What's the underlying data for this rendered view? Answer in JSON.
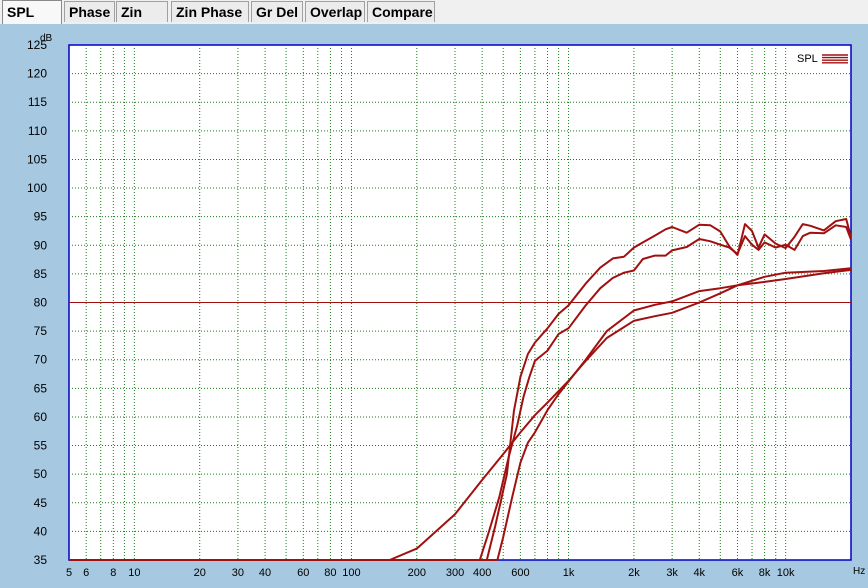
{
  "tabs": [
    {
      "label": "SPL",
      "active": true
    },
    {
      "label": "Phase"
    },
    {
      "label": "Zin"
    },
    {
      "label": "Zin Phase"
    },
    {
      "label": "Gr Del"
    },
    {
      "label": "Overlap"
    },
    {
      "label": "Compare"
    }
  ],
  "colors": {
    "background": "#a6c8e0",
    "plot_bg": "#ffffff",
    "grid": "#1a7a1a",
    "curve": "#a01010",
    "frame": "#0000c8"
  },
  "chart_data": {
    "type": "line",
    "title": "",
    "xlabel": "Hz",
    "ylabel": "dB",
    "x_scale": "log",
    "xlim": [
      5,
      20000
    ],
    "ylim": [
      35,
      125
    ],
    "grid": true,
    "legend": {
      "position": "top-right",
      "entries": [
        "SPL"
      ]
    },
    "y_ticks": [
      125,
      120,
      115,
      110,
      105,
      100,
      95,
      90,
      85,
      80,
      75,
      70,
      65,
      60,
      55,
      50,
      45,
      40,
      35
    ],
    "x_tick_labels": [
      {
        "x": 5,
        "label": "5"
      },
      {
        "x": 6,
        "label": "6"
      },
      {
        "x": 8,
        "label": "8"
      },
      {
        "x": 10,
        "label": "10"
      },
      {
        "x": 20,
        "label": "20"
      },
      {
        "x": 30,
        "label": "30"
      },
      {
        "x": 40,
        "label": "40"
      },
      {
        "x": 60,
        "label": "60"
      },
      {
        "x": 80,
        "label": "80"
      },
      {
        "x": 100,
        "label": "100"
      },
      {
        "x": 200,
        "label": "200"
      },
      {
        "x": 300,
        "label": "300"
      },
      {
        "x": 400,
        "label": "400"
      },
      {
        "x": 600,
        "label": "600"
      },
      {
        "x": 1000,
        "label": "1k"
      },
      {
        "x": 2000,
        "label": "2k"
      },
      {
        "x": 3000,
        "label": "3k"
      },
      {
        "x": 4000,
        "label": "4k"
      },
      {
        "x": 6000,
        "label": "6k"
      },
      {
        "x": 8000,
        "label": "8k"
      },
      {
        "x": 10000,
        "label": "10k"
      }
    ],
    "reference_line": {
      "y": 80
    },
    "series": [
      {
        "x": [
          5,
          150,
          200,
          300,
          400,
          500,
          600,
          700,
          800,
          1000,
          1200,
          1500,
          2000,
          2500,
          3000,
          4000,
          5000,
          6000,
          8000,
          10000,
          15000,
          20000
        ],
        "y": [
          35,
          35,
          37,
          43,
          49,
          53.5,
          57.3,
          60.3,
          62.5,
          66.3,
          69.8,
          73.8,
          76.8,
          77.6,
          78.2,
          80,
          81.6,
          83,
          84.5,
          85.2,
          85.5,
          86
        ]
      },
      {
        "x": [
          5,
          470,
          500,
          550,
          600,
          650,
          700,
          800,
          900,
          1000,
          1200,
          1500,
          2000,
          2500,
          3000,
          4000,
          5000,
          6000,
          8000,
          10000,
          15000,
          20000
        ],
        "y": [
          35,
          35,
          39,
          46,
          52,
          55.5,
          57.3,
          61.2,
          64,
          66.2,
          70,
          75,
          78.6,
          79.6,
          80.2,
          82,
          82.5,
          83,
          83.6,
          84.1,
          85.1,
          85.7
        ]
      },
      {
        "x": [
          5,
          390,
          430,
          480,
          530,
          580,
          620,
          660,
          700,
          800,
          900,
          1000,
          1200,
          1400,
          1600,
          1800,
          2000,
          2200,
          2500,
          2800,
          3000,
          3500,
          4000,
          4500,
          5000,
          5500,
          6000,
          6500,
          7000,
          7500,
          8000,
          9000,
          10000,
          11000,
          12000,
          13000,
          15000,
          17000,
          19000,
          20000
        ],
        "y": [
          35,
          35,
          40,
          46,
          53,
          58.5,
          63.5,
          67,
          69.8,
          71.6,
          74.5,
          75.5,
          79.5,
          82.5,
          84.3,
          85.2,
          85.6,
          87.6,
          88.2,
          88.2,
          89.1,
          89.7,
          91.1,
          90.7,
          90.1,
          89.6,
          88.5,
          91.6,
          90.1,
          89.2,
          90.5,
          89.6,
          90.1,
          89.2,
          91.6,
          92.2,
          92.1,
          93.5,
          93.2,
          91
        ]
      },
      {
        "x": [
          5,
          420,
          460,
          520,
          560,
          600,
          650,
          700,
          800,
          900,
          1000,
          1200,
          1400,
          1600,
          1800,
          2000,
          2200,
          2500,
          2800,
          3000,
          3500,
          4000,
          4500,
          5000,
          5500,
          6000,
          6500,
          7000,
          7500,
          8000,
          9000,
          10000,
          11000,
          12000,
          13000,
          15000,
          17000,
          19000,
          20000
        ],
        "y": [
          35,
          35,
          41,
          50,
          61,
          67,
          71,
          73,
          75.5,
          78,
          79.5,
          83.3,
          86.1,
          87.7,
          88,
          89.6,
          90.5,
          91.7,
          92.8,
          93.2,
          92.2,
          93.6,
          93.5,
          92.4,
          89.8,
          88.3,
          93.7,
          92.5,
          89.6,
          91.9,
          90.3,
          89.5,
          91.5,
          93.7,
          93.4,
          92.6,
          94.2,
          94.6,
          91.4
        ]
      }
    ]
  }
}
